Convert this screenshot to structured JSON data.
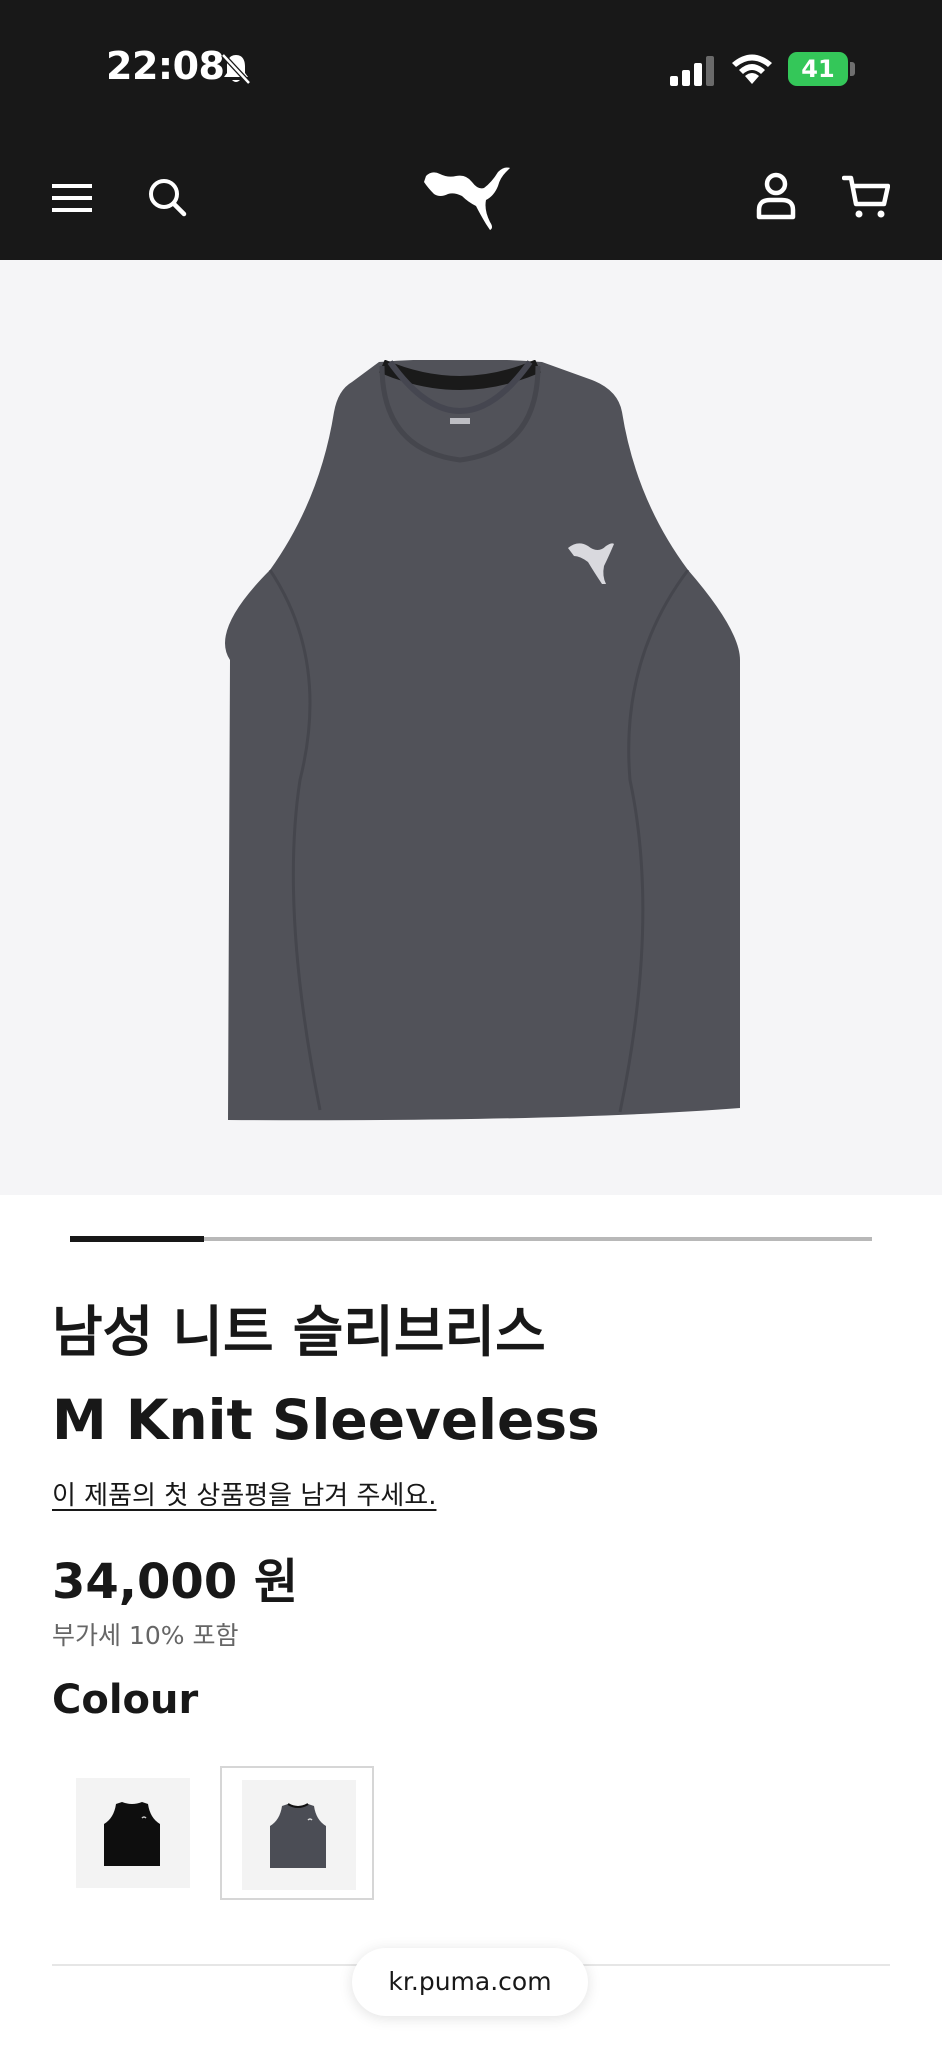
{
  "status_bar": {
    "time": "22:08",
    "battery": "41",
    "icons": [
      "bell-slash-icon",
      "signal-icon",
      "wifi-icon",
      "battery-charging-icon"
    ]
  },
  "nav": {
    "icons": [
      "menu-icon",
      "search-icon",
      "puma-logo",
      "user-icon",
      "cart-icon"
    ]
  },
  "product": {
    "title_ko": "남성 니트 슬리브리스",
    "title_en": "M Knit Sleeveless",
    "review_prompt": "이 제품의 첫 상품평을 남겨 주세요.",
    "price": "34,000 원",
    "vat_note": "부가세 10% 포함",
    "colour_label": "Colour",
    "colours": [
      {
        "swatch": "#0e0e0e",
        "selected": false
      },
      {
        "swatch": "#4b4d55",
        "selected": true
      }
    ],
    "image_position": 1
  },
  "browser": {
    "url": "kr.puma.com"
  },
  "colors": {
    "header_bg": "#181818",
    "image_bg": "#f5f5f7",
    "accent_battery": "#34c759"
  }
}
